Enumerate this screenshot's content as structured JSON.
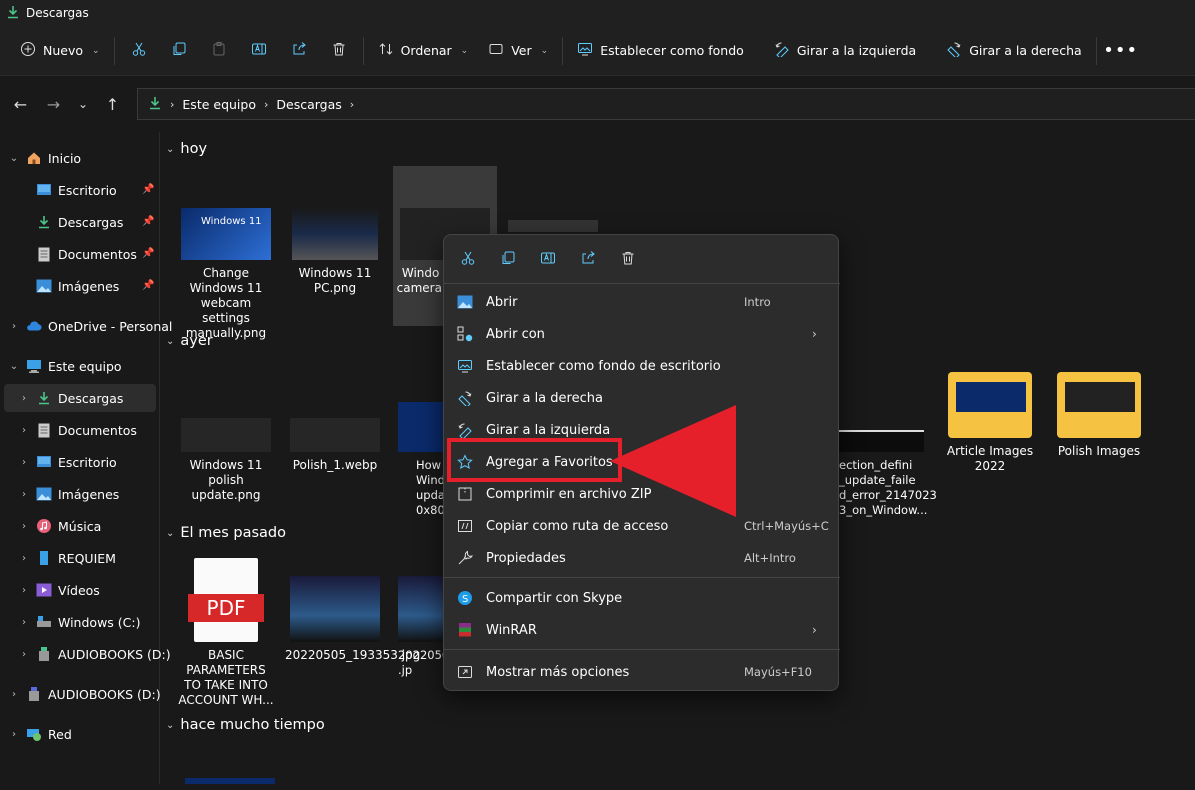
{
  "window": {
    "title": "Descargas"
  },
  "toolbar": {
    "new_label": "Nuevo",
    "sort_label": "Ordenar",
    "view_label": "Ver",
    "set_bg_label": "Establecer como fondo",
    "rotate_left_label": "Girar a la izquierda",
    "rotate_right_label": "Girar a la derecha"
  },
  "address": {
    "crumbs": [
      "Este equipo",
      "Descargas"
    ]
  },
  "sidebar": {
    "items": [
      {
        "label": "Inicio"
      },
      {
        "label": "Escritorio"
      },
      {
        "label": "Descargas"
      },
      {
        "label": "Documentos"
      },
      {
        "label": "Imágenes"
      },
      {
        "label": "OneDrive - Personal"
      },
      {
        "label": "Este equipo"
      },
      {
        "label": "Descargas"
      },
      {
        "label": "Documentos"
      },
      {
        "label": "Escritorio"
      },
      {
        "label": "Imágenes"
      },
      {
        "label": "Música"
      },
      {
        "label": "REQUIEM"
      },
      {
        "label": "Vídeos"
      },
      {
        "label": "Windows (C:)"
      },
      {
        "label": "AUDIOBOOKS (D:)"
      },
      {
        "label": "AUDIOBOOKS (D:)"
      },
      {
        "label": "Red"
      }
    ]
  },
  "groups": [
    "hoy",
    "ayer",
    "El mes pasado",
    "hace mucho tiempo"
  ],
  "files": {
    "f1": "Change Windows 11 webcam settings manually.png",
    "f2": "Windows 11 PC.png",
    "f3": "Windo manual camera location",
    "f4": "Windows 11 polish update.png",
    "f5": "Polish_1.webp",
    "f6": "How Wind updat 0x8007",
    "f7": "ection_defini _update_faile d_error_2147023 3_on_Window...",
    "f8": "Article Images 2022",
    "f9": "Polish Images",
    "f10": "BASIC PARAMETERS TO TAKE INTO ACCOUNT WH...",
    "f11": "20220505_193353.jpg",
    "f12": "2022050 .jp"
  },
  "thumbs": {
    "win11": "Windows 11",
    "pdf": "PDF"
  },
  "context_menu": {
    "items": [
      {
        "label": "Abrir",
        "shortcut": "Intro"
      },
      {
        "label": "Abrir con"
      },
      {
        "label": "Establecer como fondo de escritorio"
      },
      {
        "label": "Girar a la derecha"
      },
      {
        "label": "Girar a la izquierda"
      },
      {
        "label": "Agregar a Favoritos"
      },
      {
        "label": "Comprimir en archivo ZIP"
      },
      {
        "label": "Copiar como ruta de acceso",
        "shortcut": "Ctrl+Mayús+C"
      },
      {
        "label": "Propiedades",
        "shortcut": "Alt+Intro"
      },
      {
        "label": "Compartir con Skype"
      },
      {
        "label": "WinRAR"
      },
      {
        "label": "Mostrar más opciones",
        "shortcut": "Mayús+F10"
      }
    ]
  },
  "colors": {
    "accent": "#60cdff",
    "highlight": "#e5202a",
    "folder": "#f5c242"
  }
}
